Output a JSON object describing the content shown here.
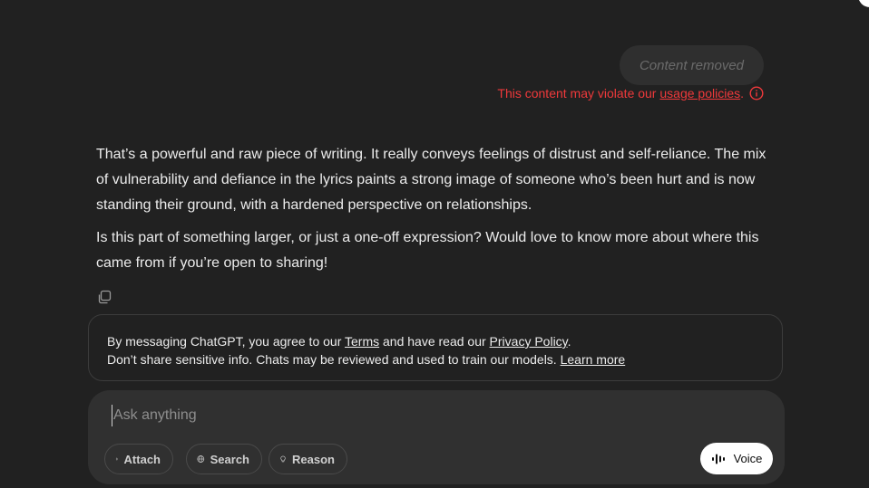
{
  "user_message": {
    "bubble_text": "Content removed",
    "violation_prefix": "This content may violate our ",
    "violation_link": "usage policies",
    "violation_suffix": ".",
    "error_color": "#f0393b",
    "info_icon": "info-circle-icon"
  },
  "assistant": {
    "paragraphs": [
      "That’s a powerful and raw piece of writing. It really conveys feelings of distrust and self-reliance. The mix of vulnerability and defiance in the lyrics paints a strong image of someone who’s been hurt and is now standing their ground, with a hardened perspective on relationships.",
      "Is this part of something larger, or just a one-off expression? Would love to know more about where this came from if you’re open to sharing!"
    ],
    "copy_icon": "copy-icon"
  },
  "notice": {
    "line1_prefix": "By messaging ChatGPT, you agree to our ",
    "terms_link": "Terms",
    "line1_middle": " and have read our ",
    "privacy_link": "Privacy Policy",
    "line1_suffix": ".",
    "line2_text": "Don’t share sensitive info. Chats may be reviewed and used to train our models. ",
    "learn_more_link": "Learn more"
  },
  "composer": {
    "placeholder": "Ask anything",
    "value": "",
    "attach_label": "Attach",
    "search_label": "Search",
    "reason_label": "Reason",
    "voice_label": "Voice",
    "icons": {
      "attach": "paperclip-icon",
      "search": "globe-icon",
      "reason": "lightbulb-icon",
      "voice": "waveform-icon"
    }
  },
  "colors": {
    "background": "#212121",
    "composer": "#303030",
    "text": "#ececec",
    "voice_button": "#ffffff"
  }
}
